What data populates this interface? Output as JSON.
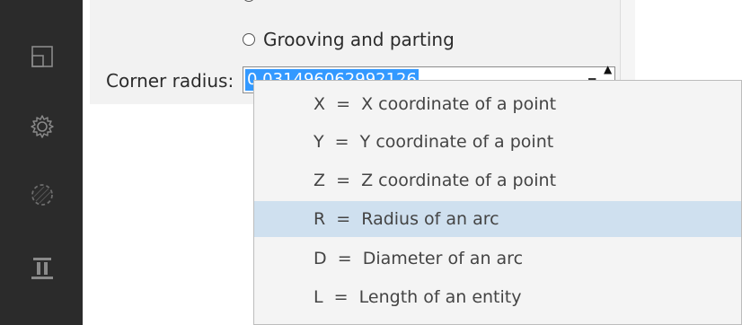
{
  "sidebar": {
    "icons": [
      "layout-icon",
      "gear-icon",
      "circle-dashed-icon",
      "tool-icon"
    ]
  },
  "panel": {
    "radio_partial_label": "",
    "radio_grooving_label": "Grooving and parting",
    "corner_radius_label": "Corner radius:",
    "corner_radius_value": "0.031496062992126"
  },
  "dropdown": {
    "items": [
      {
        "label": "X  =  X coordinate of a point",
        "selected": false
      },
      {
        "label": "Y  =  Y coordinate of a point",
        "selected": false
      },
      {
        "label": "Z  =  Z coordinate of a point",
        "selected": false
      },
      {
        "label": "R  =  Radius of an arc",
        "selected": true
      },
      {
        "label": "D  =  Diameter of an arc",
        "selected": false
      },
      {
        "label": "L  =  Length of an entity",
        "selected": false
      }
    ]
  },
  "colors": {
    "sidebar_bg": "#2b2b2b",
    "selection_bg": "#3399ff",
    "menu_highlight": "#cfe0ef"
  }
}
